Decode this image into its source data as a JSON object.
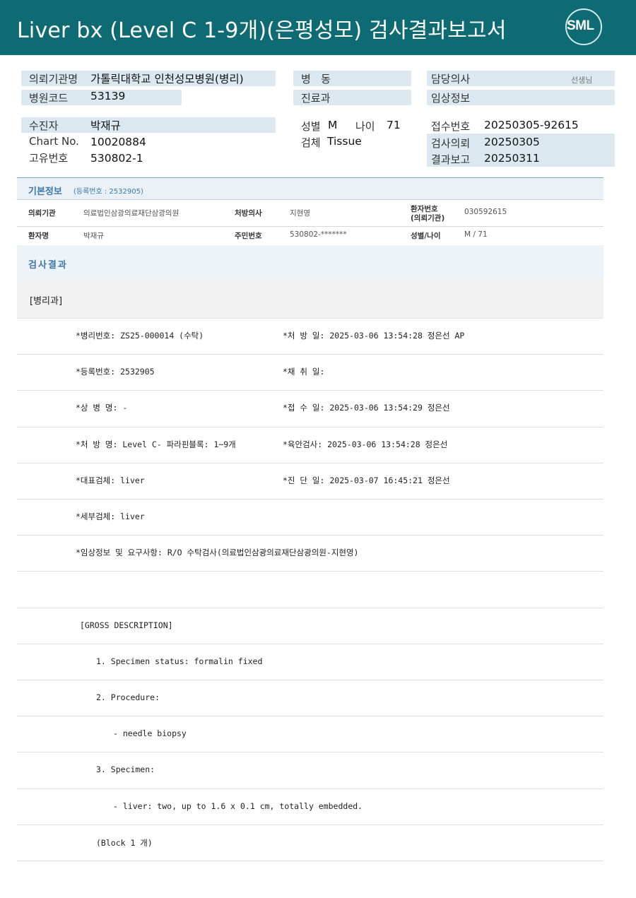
{
  "header": {
    "title": "Liver bx (Level C 1-9개)(은평성모) 검사결과보고서",
    "logo": "SML"
  },
  "info": {
    "institution_label": "의뢰기관명",
    "institution_value": "가톨릭대학교 인천성모병원(병리)",
    "hospital_code_label": "병원코드",
    "hospital_code_value": "53139",
    "patient_label": "수진자",
    "patient_value": "박재규",
    "chart_label": "Chart No.",
    "chart_value": "10020884",
    "unique_label": "고유번호",
    "unique_value": "530802-1",
    "ward_label": "병   동",
    "dept_label": "진료과",
    "sex_label": "성별",
    "sex_value": "M",
    "age_label": "나이",
    "age_value": "71",
    "specimen_label": "검체",
    "specimen_value": "Tissue",
    "doctor_label": "담당의사",
    "doctor_suffix": "선생님",
    "clinical_label": "임상정보",
    "receipt_label": "접수번호",
    "receipt_value": "20250305-92615",
    "request_label": "검사의뢰",
    "request_value": "20250305",
    "report_label": "결과보고",
    "report_value": "20250311"
  },
  "basic": {
    "title": "기본정보",
    "reg": "(등록번호 : 2532905)",
    "inst_k": "의뢰기관",
    "inst_v": "의료법인삼광의료재단삼광의원",
    "presc_k": "처방의사",
    "presc_v": "지현영",
    "pno_k1": "환자번호",
    "pno_k2": "(의뢰기관)",
    "pno_v": "030592615",
    "name_k": "환자명",
    "name_v": "박재규",
    "rrn_k": "주민번호",
    "rrn_v": "530802-*******",
    "sexage_k": "성별/나이",
    "sexage_v": "M / 71"
  },
  "result": {
    "title": "검사결과",
    "dept": "[병리과]",
    "rows": [
      {
        "left": "*병리번호: ZS25-000014 (수탁)",
        "right": "*처 방 일: 2025-03-06 13:54:28  정은선 AP"
      },
      {
        "left": "*등록번호: 2532905",
        "right": "*채 취 일:"
      },
      {
        "left": "*상 병 명: -",
        "right": "*접 수 일: 2025-03-06 13:54:29  정은선"
      },
      {
        "left": "*처 방 명: Level C- 파라핀블록: 1~9개",
        "right": "*육안검사: 2025-03-06 13:54:28  정은선"
      },
      {
        "left": "*대표검체: liver",
        "right": "*진 단 일: 2025-03-07 16:45:21  정은선"
      },
      {
        "left": "*세부검체: liver",
        "right": ""
      },
      {
        "left": "*임상정보 및 요구사항: R/O 수탁검사(의료법인삼광의료재단삼광의원-지현영)",
        "right": ""
      }
    ],
    "gross": [
      {
        "text": "[GROSS DESCRIPTION]",
        "indent": 1
      },
      {
        "text": "1. Specimen status: formalin fixed",
        "indent": 2
      },
      {
        "text": "2. Procedure:",
        "indent": 2
      },
      {
        "text": "- needle biopsy",
        "indent": 3
      },
      {
        "text": "3. Specimen:",
        "indent": 2
      },
      {
        "text": "- liver: two, up to 1.6 x 0.1 cm, totally embedded.",
        "indent": 3
      },
      {
        "text": "(Block 1 개)",
        "indent": 2
      }
    ]
  }
}
